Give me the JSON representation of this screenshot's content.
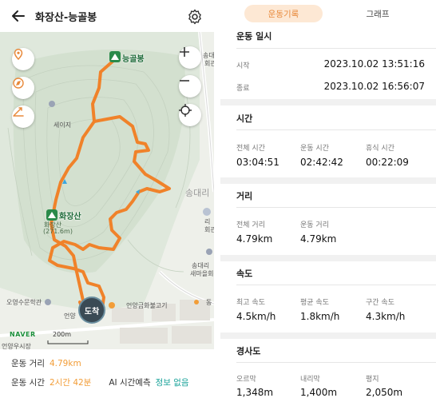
{
  "header": {
    "title": "화장산-능골봉"
  },
  "map": {
    "peaks": [
      {
        "name": "능골봉"
      },
      {
        "name": "화장산",
        "elevation": "(271.6m)"
      }
    ],
    "labels": {
      "saeji": "세이지",
      "songdae_ri_big": "송대리",
      "songdae_ri_hall": "송대리",
      "songdae_ri_hall2": "새마을회관",
      "songdae_ri_top": "송대",
      "hall_partial": "회관",
      "songdae_ri_partial": "회관",
      "ri_partial": "리",
      "museum": "오영수문학관",
      "restaurant": "언양금화불고기",
      "eonyang_partial": "언양",
      "eonyang_bottom": "언양우시장",
      "hwajang_partial": "화장산",
      "dong": "동"
    },
    "arrive_label": "도착",
    "naver": "NAVER",
    "scale": "200m"
  },
  "stats": {
    "distance_label": "운동 거리",
    "distance_value": "4.79km",
    "time_label": "운동 시간",
    "time_value": "2시간 42분",
    "ai_label": "AI 시간예측",
    "ai_link": "정보 없음"
  },
  "tabs": {
    "record": "운동기록",
    "graph": "그래프"
  },
  "sections": {
    "datetime": {
      "title": "운동 일시",
      "start_label": "시작",
      "start_value": "2023.10.02 13:51:16",
      "end_label": "종료",
      "end_value": "2023.10.02 16:56:07"
    },
    "time": {
      "title": "시간",
      "items": [
        {
          "label": "전체 시간",
          "value": "03:04:51"
        },
        {
          "label": "운동 시간",
          "value": "02:42:42"
        },
        {
          "label": "휴식 시간",
          "value": "00:22:09"
        }
      ]
    },
    "distance": {
      "title": "거리",
      "items": [
        {
          "label": "전체 거리",
          "value": "4.79km"
        },
        {
          "label": "운동 거리",
          "value": "4.79km"
        }
      ]
    },
    "speed": {
      "title": "속도",
      "items": [
        {
          "label": "최고 속도",
          "value": "4.5km/h"
        },
        {
          "label": "평균 속도",
          "value": "1.8km/h"
        },
        {
          "label": "구간 속도",
          "value": "4.3km/h"
        }
      ]
    },
    "slope": {
      "title": "경사도",
      "items": [
        {
          "label": "오르막",
          "value": "1,348m"
        },
        {
          "label": "내리막",
          "value": "1,400m"
        },
        {
          "label": "평지",
          "value": "2,050m"
        }
      ]
    }
  },
  "colors": {
    "accent": "#f29d38",
    "route": "#f0822a",
    "teal": "#1aa39a",
    "tab_bg": "#fde8d4"
  }
}
